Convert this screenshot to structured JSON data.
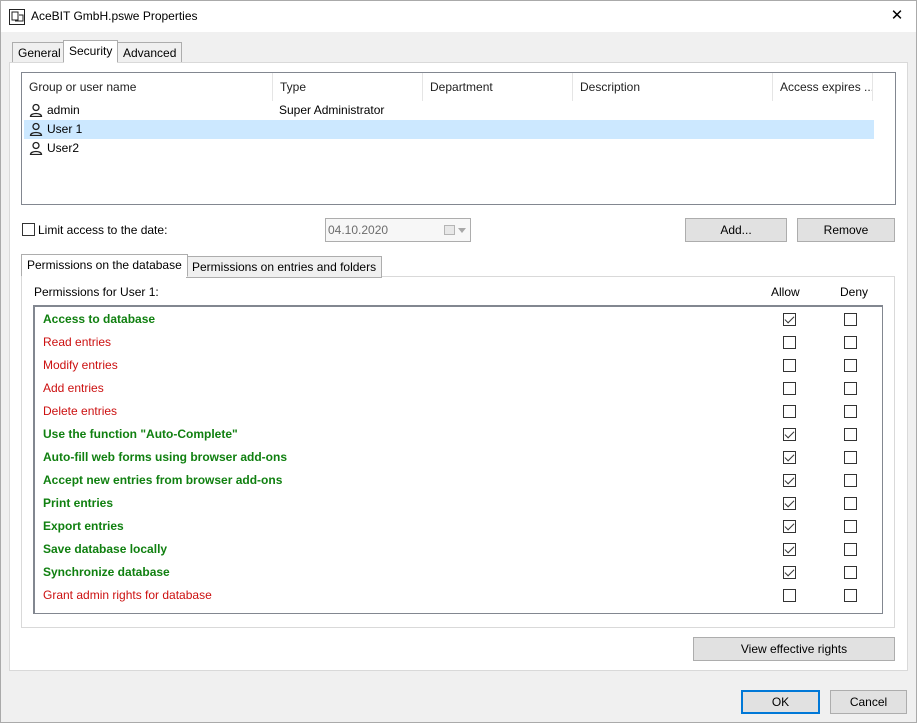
{
  "window": {
    "title": "AceBIT GmbH.pswe Properties"
  },
  "tabs": [
    {
      "label": "General"
    },
    {
      "label": "Security"
    },
    {
      "label": "Advanced"
    }
  ],
  "user_list": {
    "columns": [
      "Group or user name",
      "Type",
      "Department",
      "Description",
      "Access expires ..."
    ],
    "rows": [
      {
        "name": "admin",
        "type": "Super Administrator"
      },
      {
        "name": "User 1",
        "type": ""
      },
      {
        "name": "User2",
        "type": ""
      }
    ]
  },
  "limit_access": {
    "label": "Limit access to the date:",
    "date": "04.10.2020"
  },
  "buttons": {
    "add": "Add...",
    "remove": "Remove",
    "view_rights": "View effective rights",
    "ok": "OK",
    "cancel": "Cancel"
  },
  "perm_tabs": [
    {
      "label": "Permissions on the database"
    },
    {
      "label": "Permissions on entries and folders"
    }
  ],
  "permissions": {
    "header": "Permissions for User 1:",
    "allow": "Allow",
    "deny": "Deny",
    "items": [
      {
        "label": "Access to database",
        "color": "green"
      },
      {
        "label": "Read entries",
        "color": "red"
      },
      {
        "label": "Modify entries",
        "color": "red"
      },
      {
        "label": "Add entries",
        "color": "red"
      },
      {
        "label": "Delete entries",
        "color": "red"
      },
      {
        "label": "Use the function \"Auto-Complete\"",
        "color": "green"
      },
      {
        "label": "Auto-fill web forms using browser add-ons",
        "color": "green"
      },
      {
        "label": "Accept new entries from browser add-ons",
        "color": "green"
      },
      {
        "label": "Print entries",
        "color": "green"
      },
      {
        "label": "Export entries",
        "color": "green"
      },
      {
        "label": "Save database locally",
        "color": "green"
      },
      {
        "label": "Synchronize database",
        "color": "green"
      },
      {
        "label": "Grant admin rights for database",
        "color": "red"
      }
    ]
  },
  "colors": {
    "allowed": "#108010",
    "denied": "#cc1010",
    "accent": "#0078d7",
    "selection": "#cce8ff"
  }
}
